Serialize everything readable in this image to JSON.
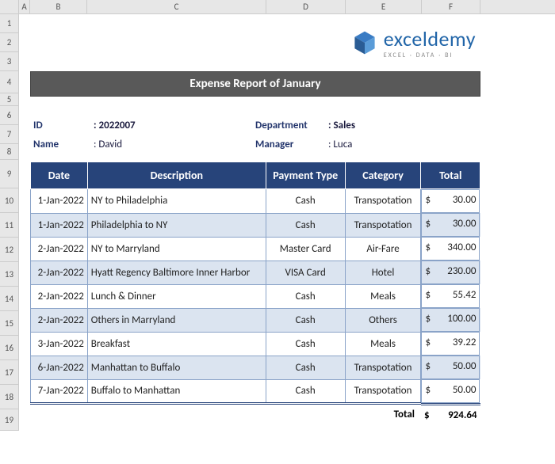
{
  "cols": [
    "A",
    "B",
    "C",
    "D",
    "E",
    "F"
  ],
  "rows": [
    "1",
    "2",
    "3",
    "4",
    "5",
    "6",
    "7",
    "8",
    "9",
    "10",
    "11",
    "12",
    "13",
    "14",
    "15",
    "16",
    "17",
    "18",
    "19"
  ],
  "logo": {
    "brand": "exceldemy",
    "tagline": "EXCEL · DATA · BI"
  },
  "title": "Expense Report of January",
  "info": {
    "id_label": "ID",
    "id_value": ": 2022007",
    "name_label": "Name",
    "name_value": ": David",
    "dept_label": "Department",
    "dept_value": ": Sales",
    "mgr_label": "Manager",
    "mgr_value": ": Luca"
  },
  "headers": {
    "date": "Date",
    "desc": "Description",
    "pay": "Payment Type",
    "cat": "Category",
    "total": "Total"
  },
  "items": [
    {
      "date": "1-Jan-2022",
      "description": "NY to Philadelphia",
      "payment": "Cash",
      "category": "Transpotation",
      "amount": "30.00"
    },
    {
      "date": "1-Jan-2022",
      "description": "Philadelphia to NY",
      "payment": "Cash",
      "category": "Transpotation",
      "amount": "30.00"
    },
    {
      "date": "2-Jan-2022",
      "description": "NY to Marryland",
      "payment": "Master Card",
      "category": "Air-Fare",
      "amount": "340.00"
    },
    {
      "date": "2-Jan-2022",
      "description": "Hyatt Regency Baltimore Inner Harbor",
      "payment": "VISA Card",
      "category": "Hotel",
      "amount": "230.00"
    },
    {
      "date": "2-Jan-2022",
      "description": "Lunch & Dinner",
      "payment": "Cash",
      "category": "Meals",
      "amount": "55.42"
    },
    {
      "date": "2-Jan-2022",
      "description": "Others in Marryland",
      "payment": "Cash",
      "category": "Others",
      "amount": "100.00"
    },
    {
      "date": "3-Jan-2022",
      "description": "Breakfast",
      "payment": "Cash",
      "category": "Meals",
      "amount": "39.22"
    },
    {
      "date": "6-Jan-2022",
      "description": "Manhattan to Buffalo",
      "payment": "Cash",
      "category": "Transpotation",
      "amount": "50.00"
    },
    {
      "date": "7-Jan-2022",
      "description": "Buffalo to Manhattan",
      "payment": "Cash",
      "category": "Transpotation",
      "amount": "50.00"
    }
  ],
  "currency": "$",
  "total_label": "Total",
  "total_value": "924.64"
}
